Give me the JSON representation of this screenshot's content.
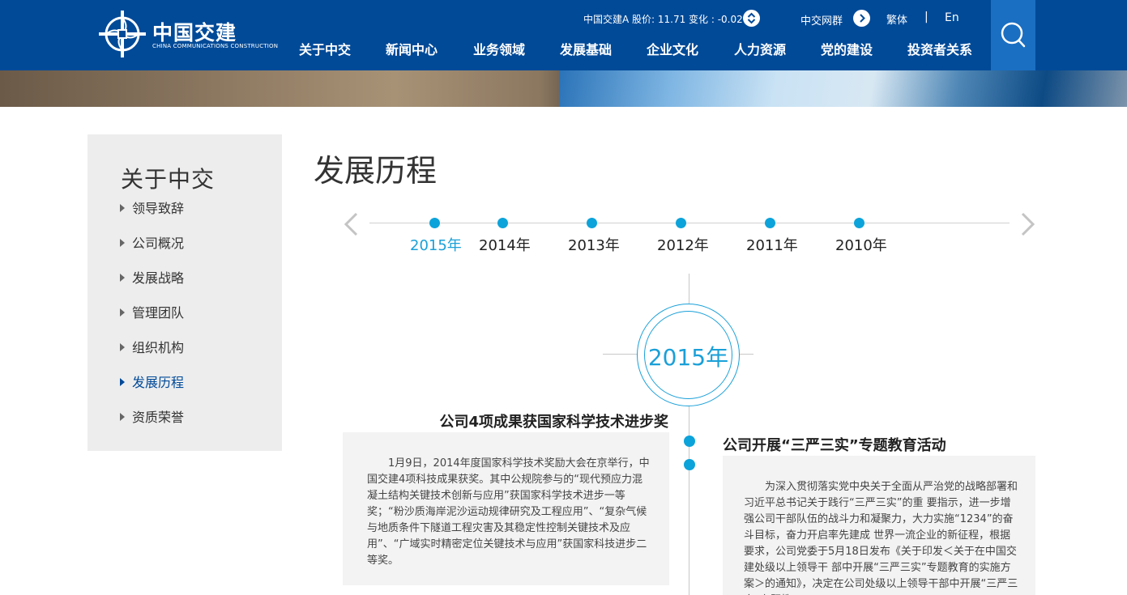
{
  "header": {
    "logo_cn": "中国交建",
    "logo_en": "CHINA COMMUNICATIONS CONSTRUCTION",
    "stock_text": "中国交建A 股价: 11.71 变化 : -0.02",
    "group_link": "中交网群",
    "lang_traditional": "繁体",
    "lang_separator": "|",
    "lang_en": "En",
    "nav": [
      "关于中交",
      "新闻中心",
      "业务领域",
      "发展基础",
      "企业文化",
      "人力资源",
      "党的建设",
      "投资者关系"
    ],
    "colors": {
      "primary": "#004a98",
      "search_bg": "#1a6fc2"
    }
  },
  "sidebar": {
    "title": "关于中交",
    "items": [
      {
        "label": "领导致辞"
      },
      {
        "label": "公司概况"
      },
      {
        "label": "发展战略"
      },
      {
        "label": "管理团队"
      },
      {
        "label": "组织机构"
      },
      {
        "label": "发展历程",
        "active": true
      },
      {
        "label": "资质荣誉"
      }
    ]
  },
  "main": {
    "title": "发展历程",
    "timeline_years": [
      "2015年",
      "2014年",
      "2013年",
      "2012年",
      "2011年",
      "2010年"
    ],
    "selected_year": "2015年",
    "accent_color": "#1aa0d8",
    "events": [
      {
        "title": "公司4项成果获国家科学技术进步奖",
        "body": "1月9日，2014年度国家科学技术奖励大会在京举行，中国交建4项科技成果获奖。其中公规院参与的“现代预应力混凝土结构关键技术创新与应用”获国家科学技术进步一等奖；“粉沙质海岸泥沙运动规律研究及工程应用”、“复杂气候与地质条件下隧道工程灾害及其稳定性控制关键技术及应用”、“广域实时精密定位关键技术与应用”获国家科技进步二等奖。"
      },
      {
        "title": "公司开展“三严三实”专题教育活动",
        "body": "为深入贯彻落实党中央关于全面从严治党的战略部署和习近平总书记关于践行“三严三实”的重 要指示，进一步增强公司干部队伍的战斗力和凝聚力，大力实施“1234”的奋斗目标，奋力开启率先建成 世界一流企业的新征程，根据要求，公司党委于5月18日发布《关于印发＜关于在中国交建处级以上领导干 部中开展“三严三实”专题教育的实施方案＞的通知》，决定在公司处级以上领导干部中开展“三严三实”专题教"
      }
    ]
  }
}
